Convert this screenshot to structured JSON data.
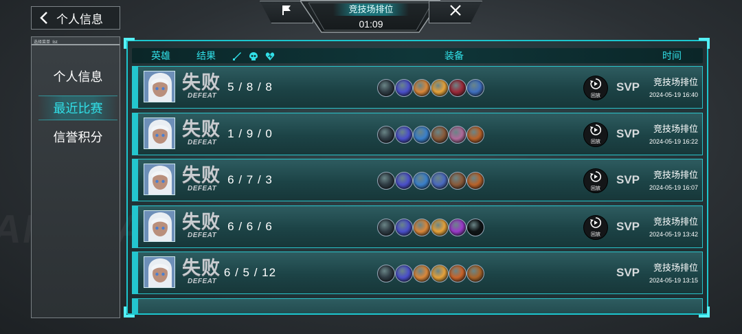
{
  "topbar": {
    "back_label": "个人信息",
    "mode_title": "竞技场排位",
    "timer": "01:09",
    "left_icon": "flag-icon",
    "right_icon": "close-icon"
  },
  "menu": {
    "tag": "选择菜单_list",
    "items": [
      {
        "label": "个人信息",
        "active": false
      },
      {
        "label": "最近比赛",
        "active": true
      },
      {
        "label": "信誉积分",
        "active": false
      }
    ]
  },
  "background_text": "AMERACING",
  "table": {
    "headers": {
      "hero": "英雄",
      "result": "结果",
      "kill_icon": "sword-icon",
      "death_icon": "skull-icon",
      "assist_icon": "heart-icon",
      "equipment": "装备",
      "time": "时间"
    },
    "rows": [
      {
        "result_cn": "失败",
        "result_en": "DEFEAT",
        "kda": "5 / 8 / 8",
        "has_replay": true,
        "replay_label": "回放",
        "svp": "SVP",
        "mode": "竞技场排位",
        "date": "2024-05-19 16:40",
        "items": [
          "#2f3c44",
          "#4a4fc9",
          "#d9873a",
          "#e6a23a",
          "#9c2a3a",
          "#3f6fbf"
        ]
      },
      {
        "result_cn": "失败",
        "result_en": "DEFEAT",
        "kda": "1 / 9 / 0",
        "has_replay": true,
        "replay_label": "回放",
        "svp": "SVP",
        "mode": "竞技场排位",
        "date": "2024-05-19 16:22",
        "items": [
          "#2f3c44",
          "#4a4fc9",
          "#3a7fc9",
          "#8a5a3a",
          "#b06a9a",
          "#b8622a"
        ]
      },
      {
        "result_cn": "失败",
        "result_en": "DEFEAT",
        "kda": "6 / 7 / 3",
        "has_replay": true,
        "replay_label": "回放",
        "svp": "SVP",
        "mode": "竞技场排位",
        "date": "2024-05-19 16:07",
        "items": [
          "#2f3c44",
          "#4a4fc9",
          "#3a7fc9",
          "#4a6abf",
          "#8a5a3a",
          "#b8622a"
        ]
      },
      {
        "result_cn": "失败",
        "result_en": "DEFEAT",
        "kda": "6 / 6 / 6",
        "has_replay": true,
        "replay_label": "回放",
        "svp": "SVP",
        "mode": "竞技场排位",
        "date": "2024-05-19 13:42",
        "items": [
          "#2f3c44",
          "#4a4fc9",
          "#d9873a",
          "#e6a23a",
          "#9a3ac9",
          "#0f1416"
        ]
      },
      {
        "result_cn": "失败",
        "result_en": "DEFEAT",
        "kda": "6 / 5 / 12",
        "has_replay": false,
        "replay_label": "",
        "svp": "SVP",
        "mode": "竞技场排位",
        "date": "2024-05-19 13:15",
        "items": [
          "#2f3c44",
          "#4a4fc9",
          "#d9873a",
          "#e6a23a",
          "#c9642a",
          "#a8642a"
        ]
      }
    ]
  },
  "colors": {
    "accent": "#31e0e8",
    "panel_border": "#1cc7cf",
    "defeat": "#c8ccd0"
  }
}
